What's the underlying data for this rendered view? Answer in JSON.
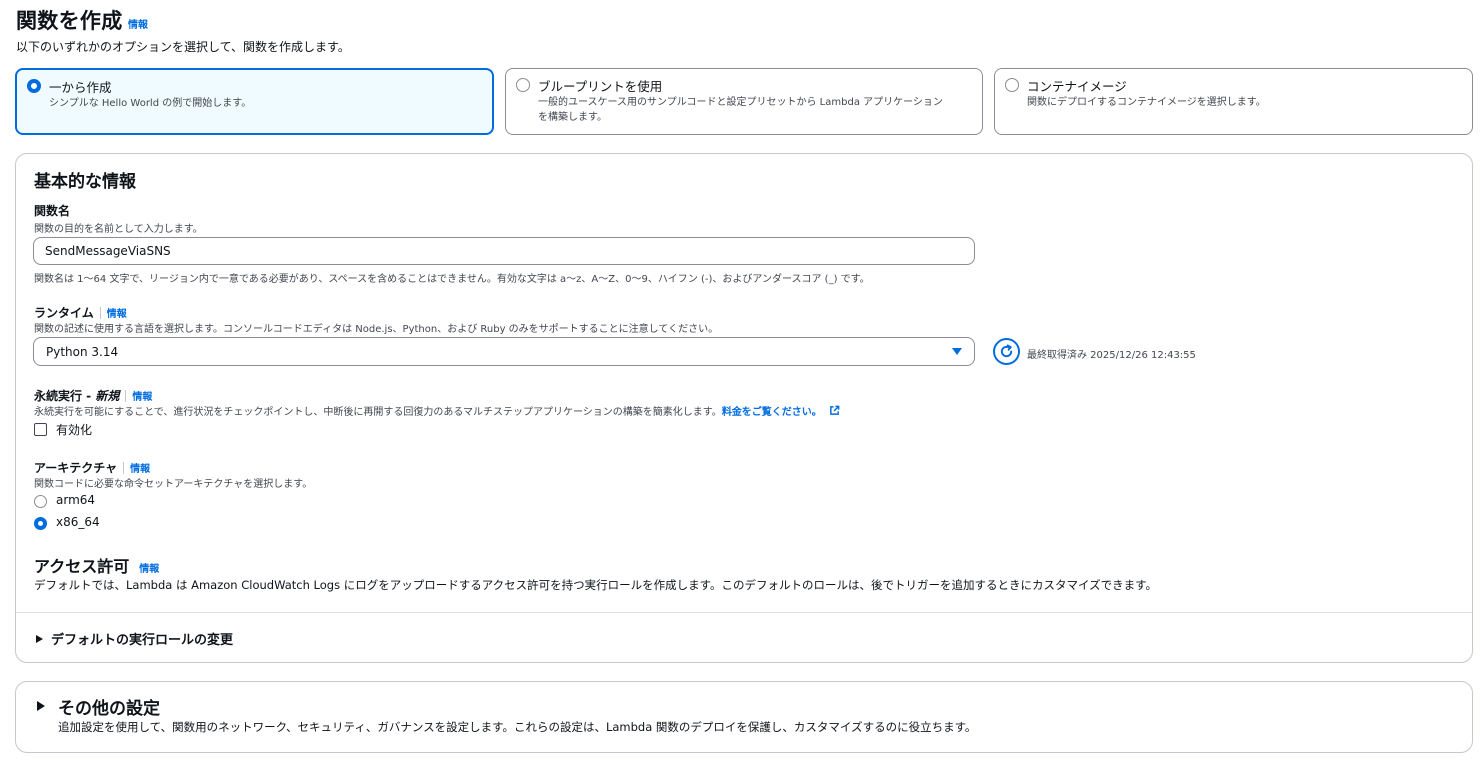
{
  "page": {
    "title": "関数を作成",
    "info": "情報",
    "description": "以下のいずれかのオプションを選択して、関数を作成します。"
  },
  "options": [
    {
      "title": "一から作成",
      "description": "シンプルな Hello World の例で開始します。",
      "selected": true
    },
    {
      "title": "ブループリントを使用",
      "description_line1": "一般的ユースケース用のサンプルコードと設定プリセットから Lambda アプリケーション",
      "description_line2": "を構築します。",
      "selected": false
    },
    {
      "title": "コンテナイメージ",
      "description": "関数にデプロイするコンテナイメージを選択します。",
      "selected": false
    }
  ],
  "basic": {
    "title": "基本的な情報",
    "function_name": {
      "label": "関数名",
      "description": "関数の目的を名前として入力します。",
      "value": "SendMessageViaSNS",
      "constraint": "関数名は 1〜64 文字で、リージョン内で一意である必要があり、スペースを含めることはできません。有効な文字は a〜z、A〜Z、0〜9、ハイフン (-)、およびアンダースコア (_) です。"
    },
    "runtime": {
      "label": "ランタイム",
      "info": "情報",
      "description": "関数の記述に使用する言語を選択します。コンソールコードエディタは Node.js、Python、および Ruby のみをサポートすることに注意してください。",
      "value": "Python 3.14",
      "last_fetched": "最終取得済み 2025/12/26 12:43:55"
    },
    "durable": {
      "label_main": "永続実行 - ",
      "label_new": "新規",
      "info": "情報",
      "description": "永続実行を可能にすることで、進行状況をチェックポイントし、中断後に再開する回復力のあるマルチステップアプリケーションの構築を簡素化します。",
      "link": "料金をご覧ください。",
      "checkbox_label": "有効化",
      "checked": false
    },
    "architecture": {
      "label": "アーキテクチャ",
      "info": "情報",
      "description": "関数コードに必要な命令セットアーキテクチャを選択します。",
      "options": [
        {
          "label": "arm64",
          "selected": false
        },
        {
          "label": "x86_64",
          "selected": true
        }
      ]
    },
    "permissions": {
      "title": "アクセス許可",
      "info": "情報",
      "description": "デフォルトでは、Lambda は Amazon CloudWatch Logs にログをアップロードするアクセス許可を持つ実行ロールを作成します。このデフォルトのロールは、後でトリガーを追加するときにカスタマイズできます。"
    },
    "role_expander": "デフォルトの実行ロールの変更"
  },
  "other": {
    "title": "その他の設定",
    "description": "追加設定を使用して、関数用のネットワーク、セキュリティ、ガバナンスを設定します。これらの設定は、Lambda 関数のデプロイを保護し、カスタマイズするのに役立ちます。"
  },
  "colors": {
    "accent": "#006ce0",
    "selected_bg": "#f0fbff",
    "border": "#8c8c94"
  }
}
